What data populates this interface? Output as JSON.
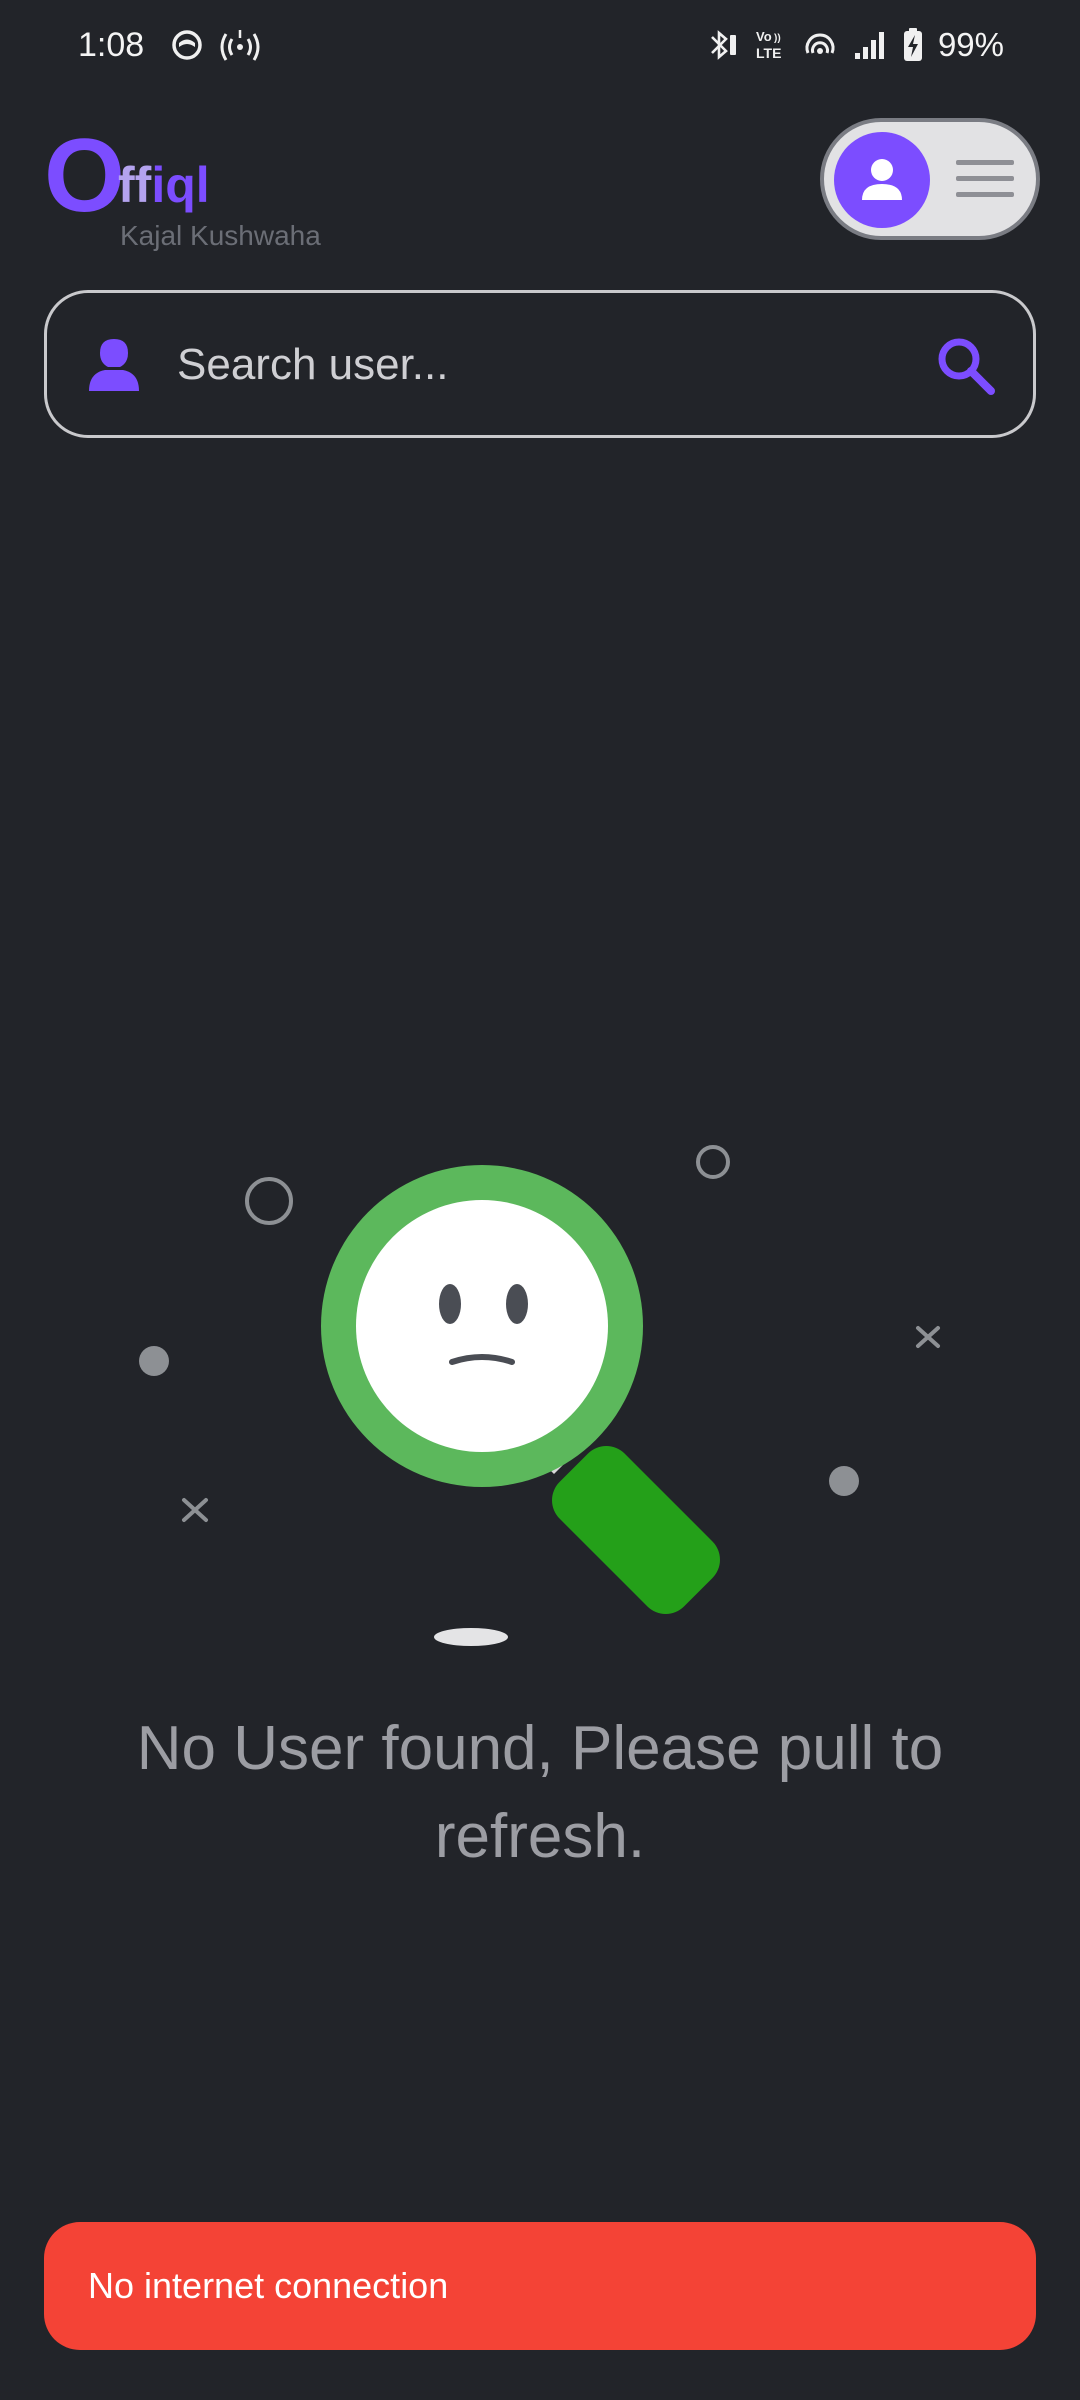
{
  "status_bar": {
    "time": "1:08",
    "battery": "99%",
    "icons_left": [
      "notification-app-icon",
      "hotspot-icon"
    ],
    "icons_right": [
      "bluetooth-icon",
      "volte-icon",
      "wifi-calling-icon",
      "signal-icon",
      "battery-charging-icon"
    ]
  },
  "header": {
    "logo_first": "O",
    "logo_part1": "ff",
    "logo_part2": "iql",
    "user_name": "Kajal Kushwaha",
    "avatar_icon": "person-icon",
    "menu_icon": "hamburger-menu-icon"
  },
  "search": {
    "placeholder": "Search user...",
    "value": "",
    "leading_icon": "user-icon",
    "trailing_icon": "search-icon"
  },
  "empty_state": {
    "message": "No User found, Please pull to refresh."
  },
  "snackbar": {
    "message": "No internet connection"
  },
  "colors": {
    "background": "#222429",
    "accent": "#7c4dff",
    "snackbar": "#f44336",
    "magnifier_ring": "#5cb85c",
    "magnifier_handle": "#24a019"
  }
}
